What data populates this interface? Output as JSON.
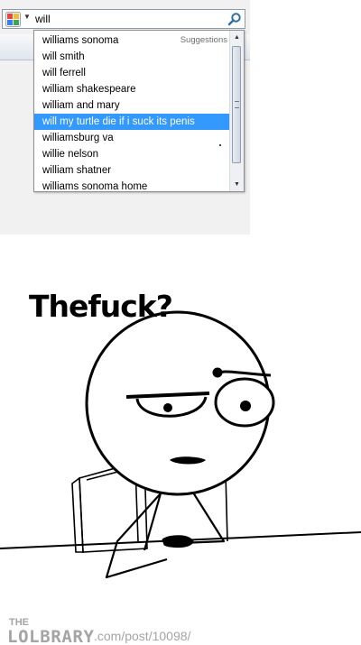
{
  "search": {
    "query": "will",
    "suggestions_heading": "Suggestions",
    "suggestions": [
      "williams sonoma",
      "will smith",
      "will ferrell",
      "william shakespeare",
      "william and mary",
      "will my turtle die if i suck its penis",
      "williamsburg va",
      "willie nelson",
      "william shatner",
      "williams sonoma home"
    ],
    "selected_index": 5,
    "engine_icon": "google-icon",
    "submit_icon": "search-icon"
  },
  "comic": {
    "caption": "Thefuck?"
  },
  "watermark": {
    "logo_text": "LOLBRARY",
    "url": ".com/post/10098/"
  },
  "colors": {
    "selection": "#3399ff",
    "watermark": "#a4a4a4"
  }
}
